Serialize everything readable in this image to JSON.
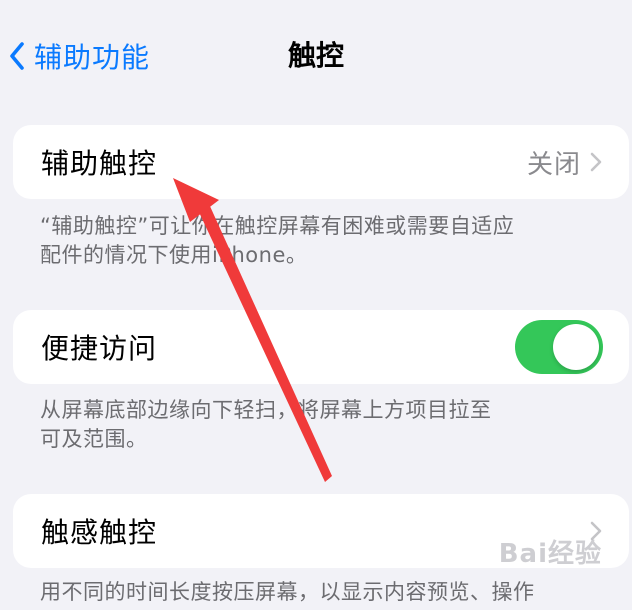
{
  "nav": {
    "back_label": "辅助功能",
    "title": "触控",
    "back_icon": "chevron-left-icon"
  },
  "rows": [
    {
      "label": "辅助触控",
      "value": "关闭",
      "footer_lines": [
        "“辅助触控”可让你在触控屏幕有困难或需要自适应",
        "配件的情况下使用iPhone。"
      ]
    },
    {
      "label": "便捷访问",
      "toggle_on": true,
      "footer_lines": [
        "从屏幕底部边缘向下轻扫，将屏幕上方项目拉至",
        "可及范围。"
      ]
    },
    {
      "label": "触感触控",
      "footer_lines": [
        "用不同的时间长度按压屏幕，以显示内容预览、操作"
      ]
    }
  ],
  "colors": {
    "accent": "#0a7aff",
    "toggle_on": "#34c759",
    "annotation_arrow": "#f03a3a"
  },
  "watermark": "Bai经验"
}
